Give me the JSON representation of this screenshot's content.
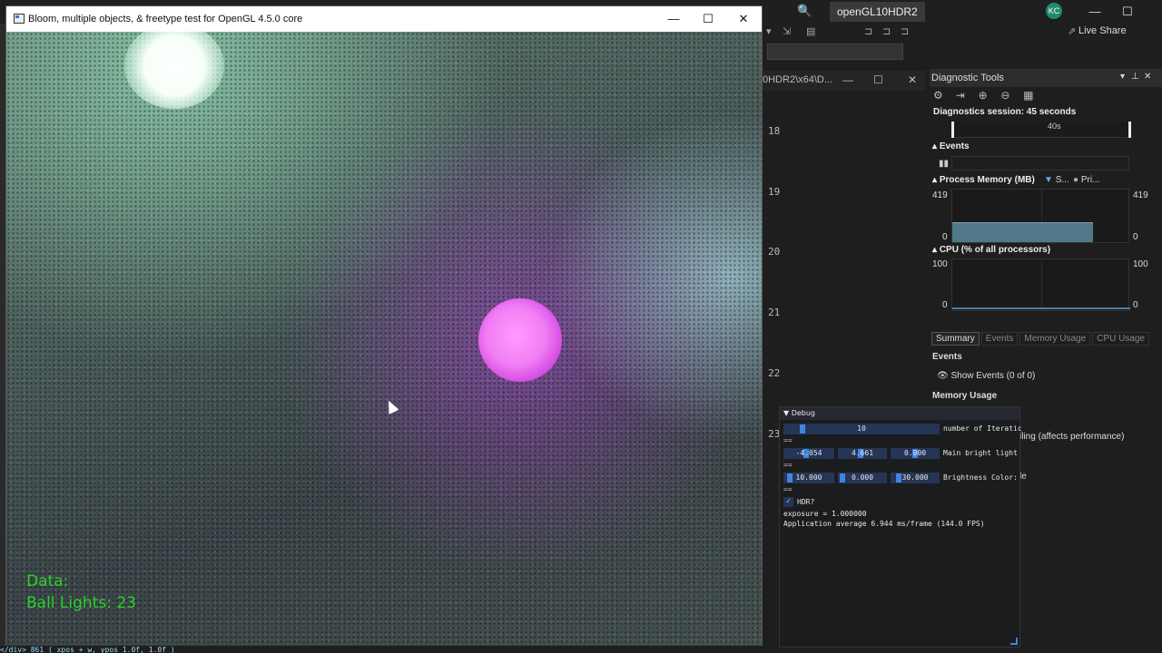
{
  "vs": {
    "solution_name": "openGL10HDR2",
    "avatar_initials": "KC",
    "live_share": "Live Share",
    "window_minimize": "—",
    "window_maximize": "☐",
    "window_close": "✕"
  },
  "editor": {
    "tab_path": "0HDR2\\x64\\D...",
    "line_numbers": [
      "18",
      "19",
      "20",
      "21",
      "22",
      "23"
    ]
  },
  "diagnostic_tools": {
    "title": "Diagnostic Tools",
    "session": "Diagnostics session: 45 seconds",
    "timeline_label": "40s",
    "events_header": "Events",
    "process_memory_header": "Process Memory (MB)",
    "legend_snapshot": "S...",
    "legend_private": "Pri...",
    "memory_max_left": "419",
    "memory_min_left": "0",
    "memory_max_right": "419",
    "memory_min_right": "0",
    "cpu_header": "CPU (% of all processors)",
    "cpu_max_left": "100",
    "cpu_min_left": "0",
    "cpu_max_right": "100",
    "cpu_min_right": "0",
    "tabs": [
      "Summary",
      "Events",
      "Memory Usage",
      "CPU Usage"
    ],
    "summary_events_header": "Events",
    "show_events": "Show Events (0 of 0)",
    "memory_usage_header": "Memory Usage",
    "profiling_note": "iling (affects performance)",
    "brightness_note": "le"
  },
  "imgui": {
    "window_title": "Debug",
    "iterations_value": "10",
    "iterations_label": "number of Iteratic",
    "light_x": "-4.054",
    "light_y": "4.661",
    "light_z": "0.000",
    "light_label": "Main bright light",
    "color_r": "10.000",
    "color_g": "0.000",
    "color_b": "30.000",
    "color_label": "Brightness Color:",
    "separator": "==",
    "hdr_label": "HDR?",
    "hdr_checked": "✓",
    "exposure": "exposure = 1.000000",
    "fps": "Application average 6.944 ms/frame (144.0 FPS)"
  },
  "gl_window": {
    "title": "Bloom, multiple objects, & freetype test for OpenGL 4.5.0 core",
    "minimize": "—",
    "maximize": "☐",
    "close": "✕",
    "hud_line1": "Data:",
    "hud_line2": "Ball Lights: 23"
  },
  "bottom_strip": {
    "code_fragment": "</div>        861      ( xpos + w, ypos         1.0f, 1.0f )"
  },
  "colors": {
    "imgui_accent": "#3d85e0",
    "hud_text": "#2ad12a",
    "orb": "#f27ef5",
    "memory_bar": "#51788a"
  }
}
